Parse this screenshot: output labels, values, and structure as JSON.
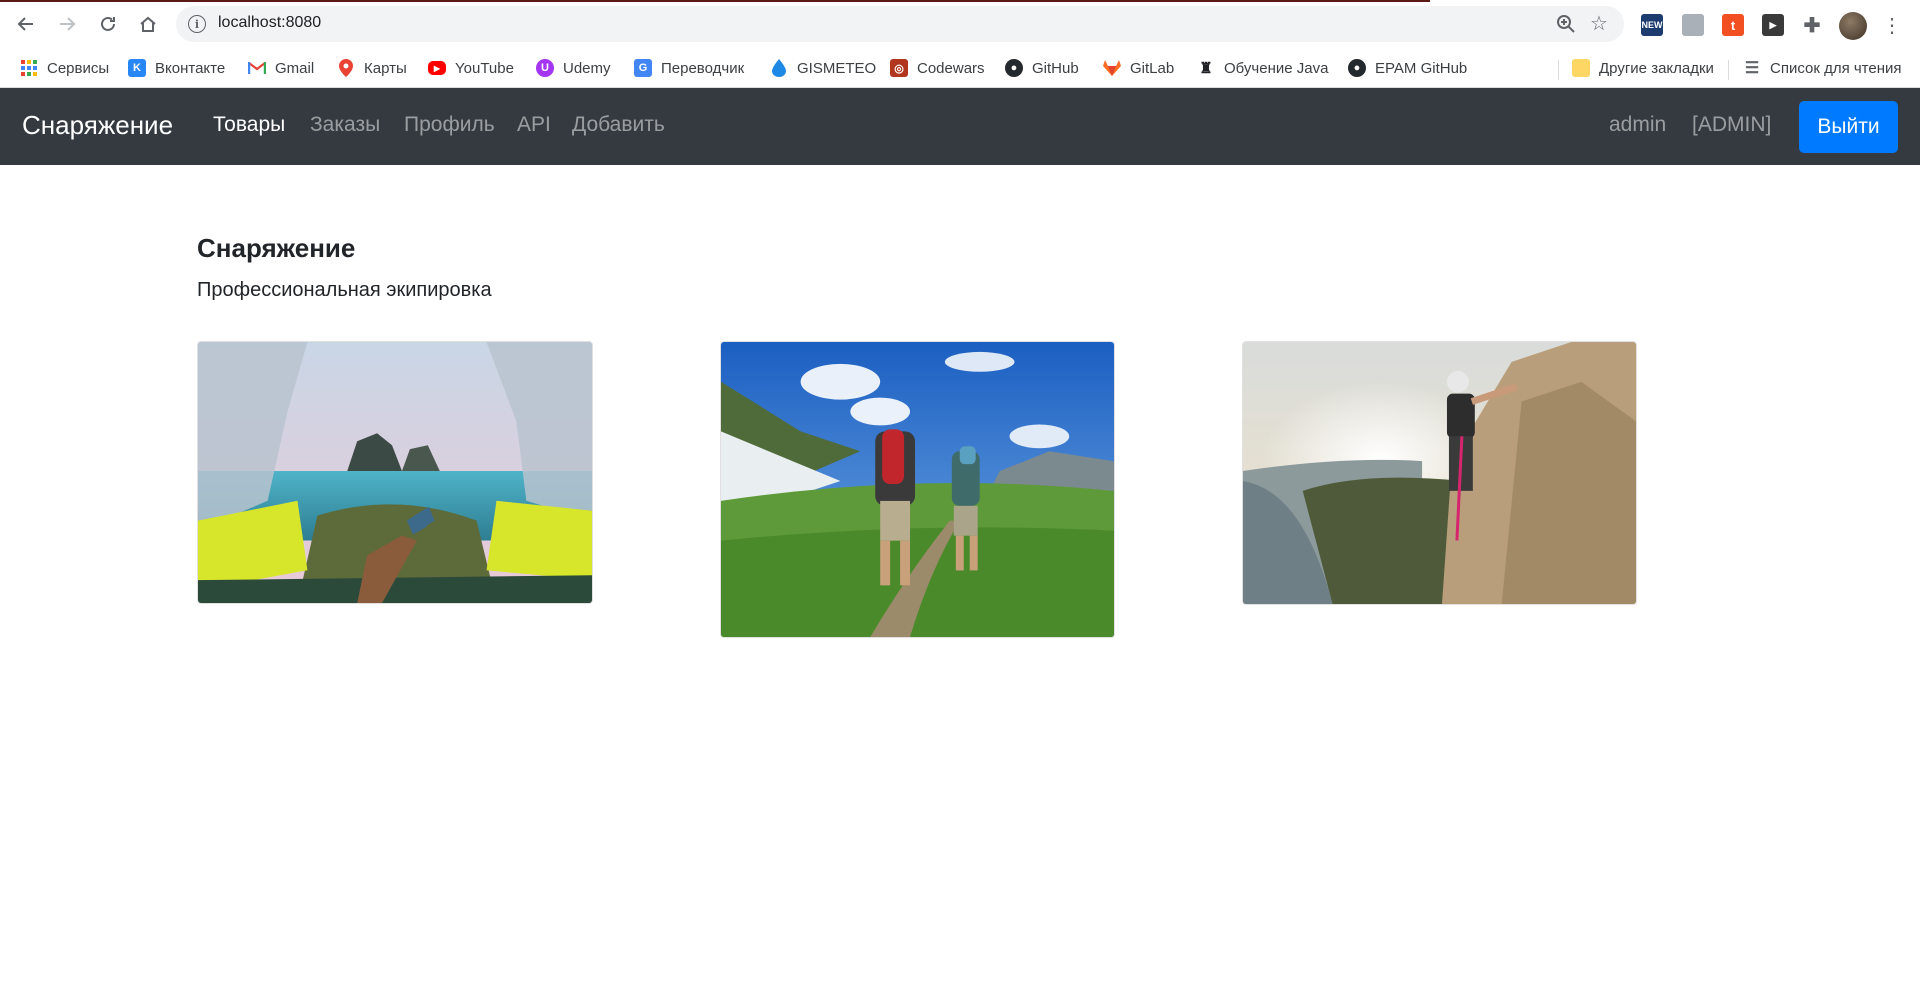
{
  "browser": {
    "url": "localhost:8080",
    "bookmarks": [
      {
        "label": "Сервисы",
        "icon": "apps-grid-icon"
      },
      {
        "label": "Вконтакте",
        "icon": "vk-icon"
      },
      {
        "label": "Gmail",
        "icon": "gmail-icon"
      },
      {
        "label": "Карты",
        "icon": "maps-pin-icon"
      },
      {
        "label": "YouTube",
        "icon": "youtube-icon"
      },
      {
        "label": "Udemy",
        "icon": "udemy-icon"
      },
      {
        "label": "Переводчик",
        "icon": "translate-icon"
      },
      {
        "label": "GISMETEO",
        "icon": "gismeteo-drop-icon"
      },
      {
        "label": "Codewars",
        "icon": "codewars-icon"
      },
      {
        "label": "GitHub",
        "icon": "github-icon"
      },
      {
        "label": "GitLab",
        "icon": "gitlab-icon"
      },
      {
        "label": "Обучение Java",
        "icon": "java-icon"
      },
      {
        "label": "EPAM GitHub",
        "icon": "github-icon"
      }
    ],
    "other_bookmarks": "Другие закладки",
    "reading_list": "Список для чтения"
  },
  "navbar": {
    "brand": "Снаряжение",
    "links": [
      {
        "label": "Товары",
        "active": true
      },
      {
        "label": "Заказы",
        "active": false
      },
      {
        "label": "Профиль",
        "active": false
      },
      {
        "label": "API",
        "active": false
      },
      {
        "label": "Добавить",
        "active": false
      }
    ],
    "username": "admin",
    "role": "[ADMIN]",
    "logout_label": "Выйти",
    "colors": {
      "background": "#343a40",
      "button": "#007bff"
    }
  },
  "main": {
    "title": "Снаряжение",
    "subtitle": "Профессиональная экипировка",
    "images": [
      {
        "name": "tent-view-image"
      },
      {
        "name": "hikers-image"
      },
      {
        "name": "climber-image"
      }
    ]
  }
}
